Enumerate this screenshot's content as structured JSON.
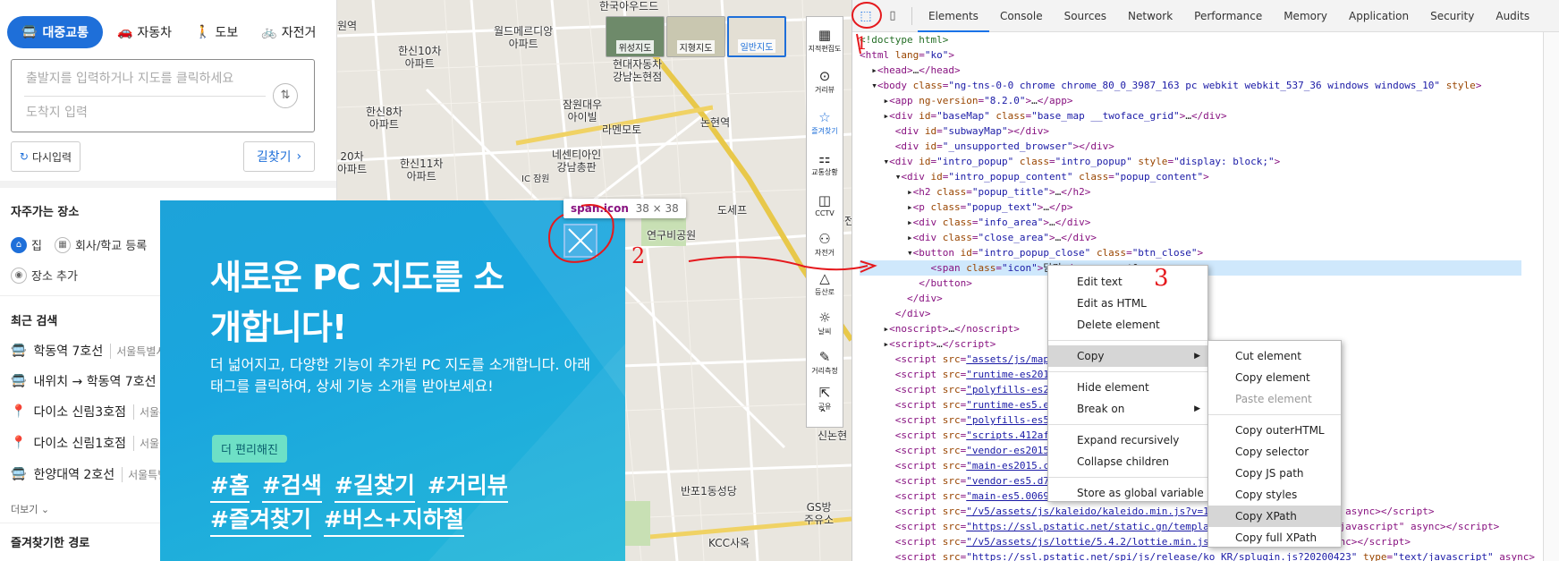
{
  "left": {
    "modes": [
      {
        "label": "대중교통",
        "icon": "bus-icon",
        "active": true
      },
      {
        "label": "자동차",
        "icon": "car-icon"
      },
      {
        "label": "도보",
        "icon": "walk-icon"
      },
      {
        "label": "자전거",
        "icon": "bike-icon"
      }
    ],
    "origin_placeholder": "출발지를 입력하거나 지도를 클릭하세요",
    "dest_placeholder": "도착지 입력",
    "reset_label": "다시입력",
    "go_label": "길찾기",
    "frequent_title": "자주가는 장소",
    "home_label": "집",
    "work_label": "회사/학교 등록",
    "add_place_label": "장소 추가",
    "recent_title": "최근 검색",
    "recent": [
      {
        "icon": "bus-icon",
        "text": "학동역 7호선",
        "sub": "서울특별시"
      },
      {
        "icon": "bus-icon",
        "text": "내위치 → 학동역 7호선",
        "sub": ""
      },
      {
        "icon": "pin-icon",
        "text": "다이소 신림3호점",
        "sub": "서울특"
      },
      {
        "icon": "pin-icon",
        "text": "다이소 신림1호점",
        "sub": "서울"
      },
      {
        "icon": "bus-icon",
        "text": "한양대역 2호선",
        "sub": "서울특별"
      }
    ],
    "more_label": "더보기 ⌄",
    "fav_route_title": "즐겨찾기한 경로"
  },
  "map": {
    "labels": [
      {
        "t": "원역"
      },
      {
        "t": "월드메르디앙\n아파트"
      },
      {
        "t": "한신10차\n아파트"
      },
      {
        "t": "현대자동차\n강남논현점"
      },
      {
        "t": "한신8차\n아파트"
      },
      {
        "t": "잠원대우\n아이빌"
      },
      {
        "t": "라멘모토"
      },
      {
        "t": "논현역"
      },
      {
        "t": "한신11차\n아파트"
      },
      {
        "t": "20차\n아파트"
      },
      {
        "t": "네센티아인\n강남총판"
      },
      {
        "t": "IC 잠원"
      },
      {
        "t": "도세프"
      },
      {
        "t": "연구비공원"
      },
      {
        "t": "반포1동성당"
      },
      {
        "t": "KCC사옥"
      },
      {
        "t": "신논현"
      },
      {
        "t": "GS방\n주유소"
      },
      {
        "t": "동전"
      },
      {
        "t": "한국아우드드"
      }
    ],
    "map_types": [
      "위성지도",
      "지형지도",
      "일반지도"
    ],
    "tools": [
      {
        "icon": "cadastral-icon",
        "label": "지적편집도"
      },
      {
        "icon": "distance-icon",
        "label": "거리뷰"
      },
      {
        "icon": "star-icon",
        "label": "즐겨찾기"
      },
      {
        "icon": "traffic-icon",
        "label": "교통상황"
      },
      {
        "icon": "cctv-icon",
        "label": "CCTV"
      },
      {
        "icon": "bike-icon",
        "label": "자전거"
      },
      {
        "icon": "mountain-icon",
        "label": "등산로"
      },
      {
        "icon": "weather-icon",
        "label": "날씨"
      },
      {
        "icon": "ruler-icon",
        "label": "거리측정"
      },
      {
        "icon": "share-icon",
        "label": "공유"
      }
    ]
  },
  "popup": {
    "title": "새로운 PC 지도를 소개합니다!",
    "text": "더 넓어지고, 다양한 기능이 추가된 PC 지도를 소개합니다. 아래 태그를 클릭하여, 상세 기능 소개를 받아보세요!",
    "badge": "더 편리해진",
    "tags": [
      "#홈",
      "#검색",
      "#길찾기",
      "#거리뷰",
      "#즐겨찾기",
      "#버스+지하철"
    ]
  },
  "tooltip": {
    "name": "span.icon",
    "size": "38 × 38"
  },
  "annotations": {
    "n1": "1",
    "n2": "2",
    "n3": "3"
  },
  "devtools": {
    "tabs": [
      "Elements",
      "Console",
      "Sources",
      "Network",
      "Performance",
      "Memory",
      "Application",
      "Security",
      "Audits"
    ],
    "active_tab": "Elements",
    "ctx_menu": [
      "Edit text",
      "Edit as HTML",
      "Delete element",
      "Copy",
      "Hide element",
      "Break on",
      "Expand recursively",
      "Collapse children",
      "Store as global variable"
    ],
    "copy_menu": [
      "Cut element",
      "Copy element",
      "Paste element",
      "Copy outerHTML",
      "Copy selector",
      "Copy JS path",
      "Copy styles",
      "Copy XPath",
      "Copy full XPath"
    ],
    "selected_copy_item": "Copy XPath"
  }
}
